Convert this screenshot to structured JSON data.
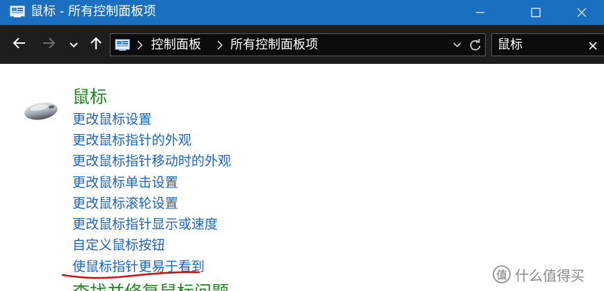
{
  "window": {
    "title": "鼠标 - 所有控制面板项",
    "accent_color": "#1b6fc0"
  },
  "titlebar": {
    "app_icon": "control-panel-icon",
    "minimize_icon": "minimize-icon",
    "maximize_icon": "maximize-icon",
    "close_icon": "close-icon"
  },
  "navigation": {
    "back_icon": "arrow-left-icon",
    "forward_icon": "arrow-right-icon",
    "recent_icon": "chevron-down-icon",
    "up_icon": "arrow-up-icon"
  },
  "address": {
    "icon": "control-panel-icon",
    "breadcrumbs": [
      "控制面板",
      "所有控制面板项"
    ]
  },
  "search": {
    "value": "鼠标"
  },
  "content": {
    "group_title": "鼠标",
    "group_title_color": "#1e8a1e",
    "link_color": "#1a64c8",
    "links": [
      "更改鼠标设置",
      "更改鼠标指针的外观",
      "更改鼠标指针移动时的外观",
      "更改鼠标单击设置",
      "更改鼠标滚轮设置",
      "更改鼠标指针显示或速度",
      "自定义鼠标按钮",
      "使鼠标指针更易于看到"
    ],
    "next_group_partial": "查找并修复鼠标问题"
  },
  "annotation": {
    "color": "#d01010",
    "target_link": "更改鼠标滚轮设置"
  },
  "watermark": {
    "badge": "值",
    "text": "什么值得买"
  }
}
